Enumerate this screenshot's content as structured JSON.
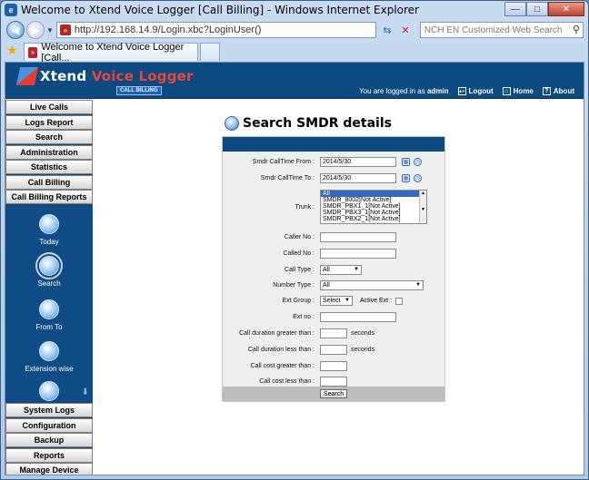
{
  "window": {
    "title": "Welcome to Xtend Voice Logger [Call Billing] - Windows Internet Explorer",
    "minimize": "—",
    "maximize": "□",
    "close": "✕"
  },
  "browser": {
    "url": "http://192.168.14.9/Login.xbc?LoginUser()",
    "search_placeholder": "NCH EN Customized Web Search",
    "tab_title": "Welcome to Xtend Voice Logger [Call..."
  },
  "header": {
    "logo_xtend": "Xtend",
    "logo_rest": "Voice Logger",
    "logo_tag": "CALL BILLING",
    "logged_in_prefix": "You are logged in as",
    "username": "admin",
    "links": [
      "Logout",
      "Home",
      "About"
    ]
  },
  "sidebar": {
    "top_items": [
      "Live Calls",
      "Logs Report",
      "Search",
      "Administration",
      "Statistics",
      "Call Billing",
      "Call Billing Reports"
    ],
    "sub_items": [
      "Today",
      "Search",
      "From To",
      "Extension wise"
    ],
    "active_sub_item": "Search",
    "bottom_items": [
      "System Logs",
      "Configuration",
      "Backup",
      "Reports",
      "Manage Device"
    ]
  },
  "main": {
    "heading": "Search SMDR details"
  },
  "form": {
    "from_label": "Smdr CallTime From :",
    "from_value": "2014/5/30",
    "to_label": "Smdr CallTime To :",
    "to_value": "2014/5/30",
    "trunk_label": "Trunk :",
    "trunk_options": [
      "All",
      "SMDR_8002[Not Active]",
      "SMDR_PBX1_1[Not Active]",
      "SMDR_PBX3_1[Not Active]",
      "SMDR_PBX2_1[Not Active]"
    ],
    "trunk_selected": "All",
    "caller_label": "Caller No :",
    "called_label": "Called No :",
    "calltype_label": "Call Type :",
    "calltype_value": "All",
    "numbertype_label": "Number Type :",
    "numbertype_value": "All",
    "extgroup_label": "Ext Group :",
    "extgroup_value": "Select",
    "activeext_label": "Active Ext :",
    "extno_label": "Ext no :",
    "dur_gt_label": "Call duration greater than :",
    "dur_lt_label": "Call duration less than :",
    "seconds": "seconds",
    "cost_gt_label": "Call cost greater than :",
    "cost_lt_label": "Call cost less than :",
    "search_button": "Search"
  }
}
